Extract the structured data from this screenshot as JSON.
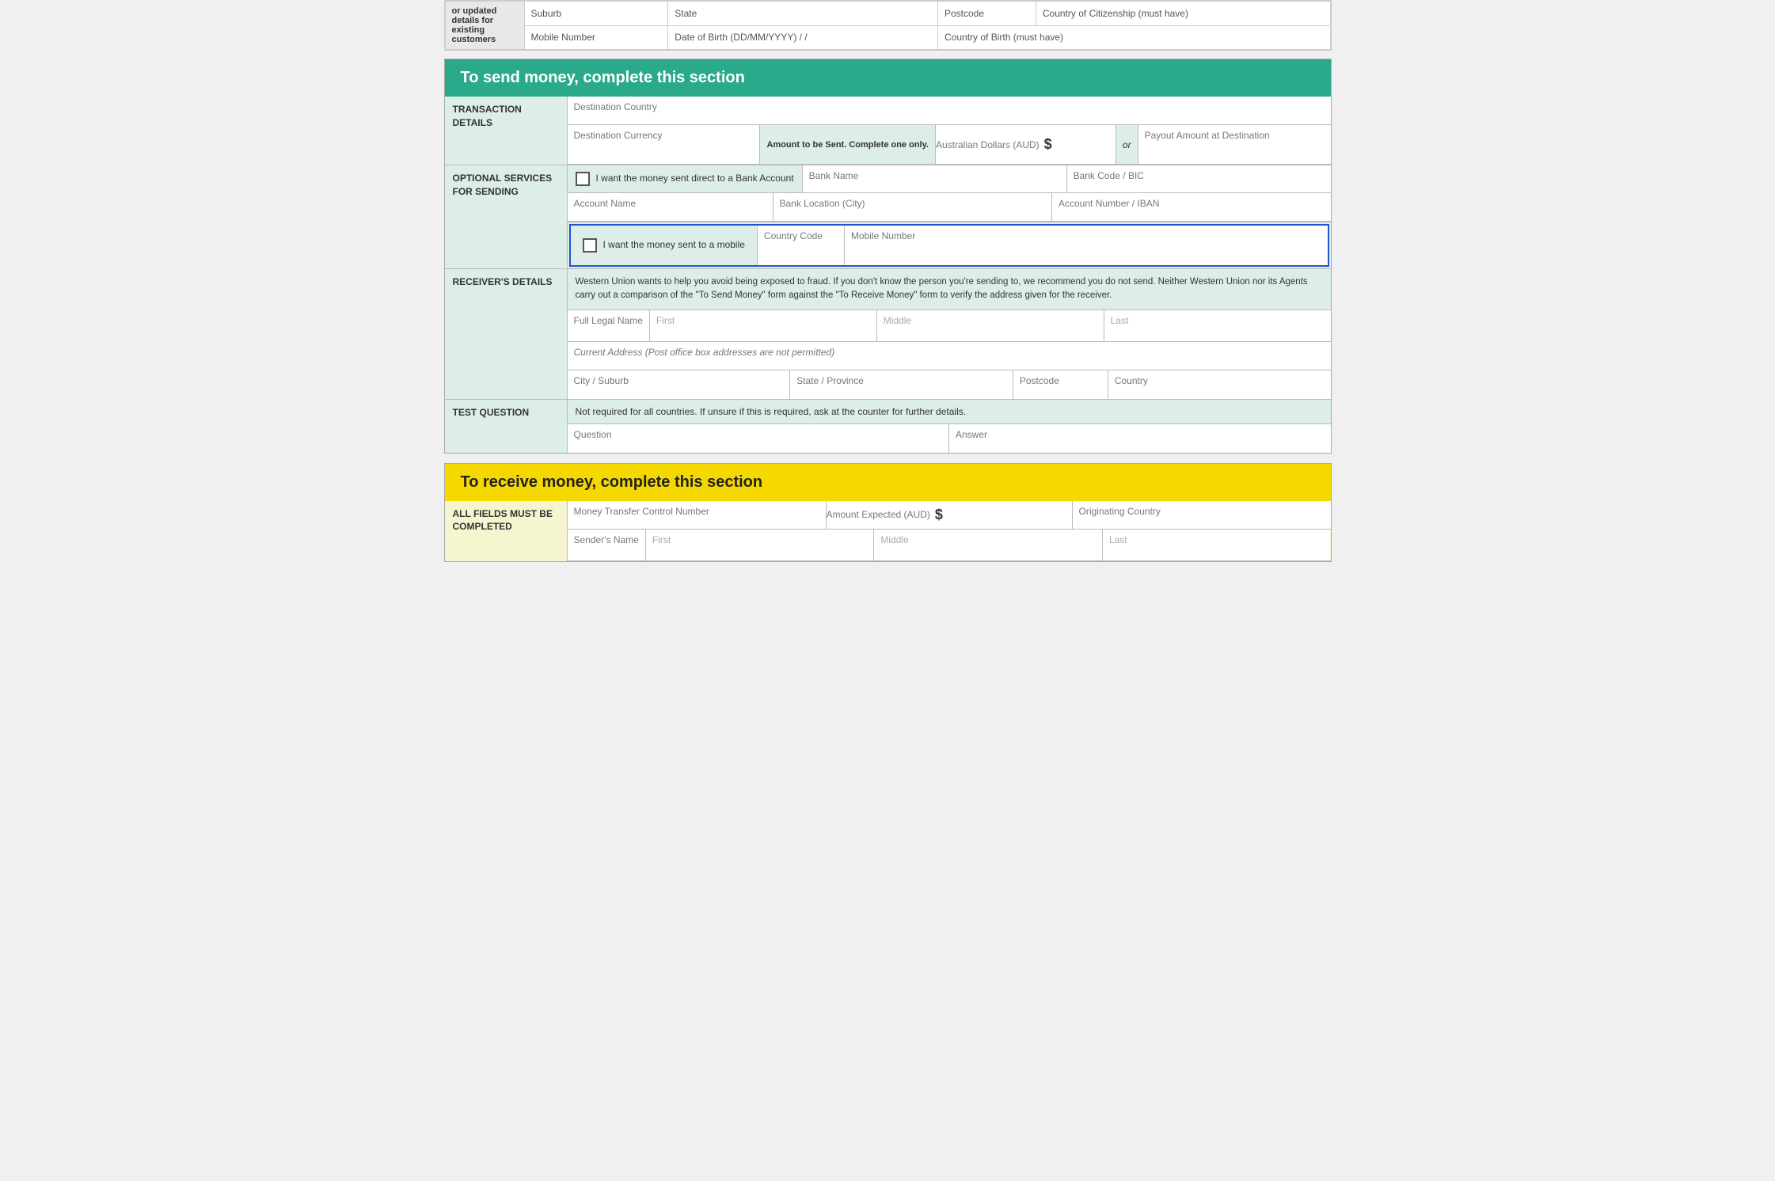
{
  "top": {
    "row1": {
      "fields": [
        "Suburb",
        "State",
        "Postcode",
        "Country of Citizenship (must have)"
      ]
    },
    "row2": {
      "fields": [
        "Mobile Number",
        "Date of Birth (DD/MM/YYYY) / /",
        "Country of Birth (must have)"
      ]
    }
  },
  "send_section": {
    "header": "To send money, complete this section",
    "transaction": {
      "label": "TRANSACTION DETAILS",
      "destination_country": "Destination Country",
      "destination_currency": "Destination Currency",
      "amount_label": "Amount to be Sent. Complete one only.",
      "aud_label": "Australian Dollars (AUD)",
      "dollar_sign": "$",
      "or_label": "or",
      "payout_label": "Payout Amount at Destination"
    },
    "optional": {
      "label": "OPTIONAL SERVICES FOR SENDING",
      "bank_checkbox_label": "I want the money sent direct to a Bank Account",
      "bank_name": "Bank Name",
      "bank_code": "Bank Code / BIC",
      "account_name": "Account Name",
      "bank_location": "Bank Location (City)",
      "account_number": "Account Number / IBAN",
      "mobile_checkbox_label": "I want the money sent to a mobile",
      "country_code": "Country Code",
      "mobile_number": "Mobile Number"
    },
    "receiver": {
      "label": "RECEIVER'S DETAILS",
      "warning": "Western Union wants to help you avoid being exposed to fraud. If you don't know the person you're sending to, we recommend you do not send.\nNeither Western Union nor its Agents carry out a comparison of the \"To Send Money\" form against the \"To Receive Money\" form to verify the address given for the receiver.",
      "full_legal_name": "Full Legal Name",
      "first": "First",
      "middle": "Middle",
      "last": "Last",
      "current_address": "Current Address  (Post office box addresses are not permitted)",
      "city_suburb": "City / Suburb",
      "state_province": "State / Province",
      "postcode": "Postcode",
      "country": "Country"
    },
    "test_question": {
      "label": "TEST QUESTION",
      "note": "Not required for all countries. If unsure if this is required, ask at the counter for further details.",
      "question": "Question",
      "answer": "Answer"
    }
  },
  "receive_section": {
    "header": "To receive money, complete this section",
    "all_fields_label": "All fields must be completed",
    "mtcn": "Money Transfer Control Number",
    "amount_expected": "Amount Expected (AUD)",
    "dollar_sign": "$",
    "originating_country": "Originating Country",
    "senders_name": "Sender's Name",
    "first": "First",
    "middle": "Middle",
    "last": "Last"
  }
}
